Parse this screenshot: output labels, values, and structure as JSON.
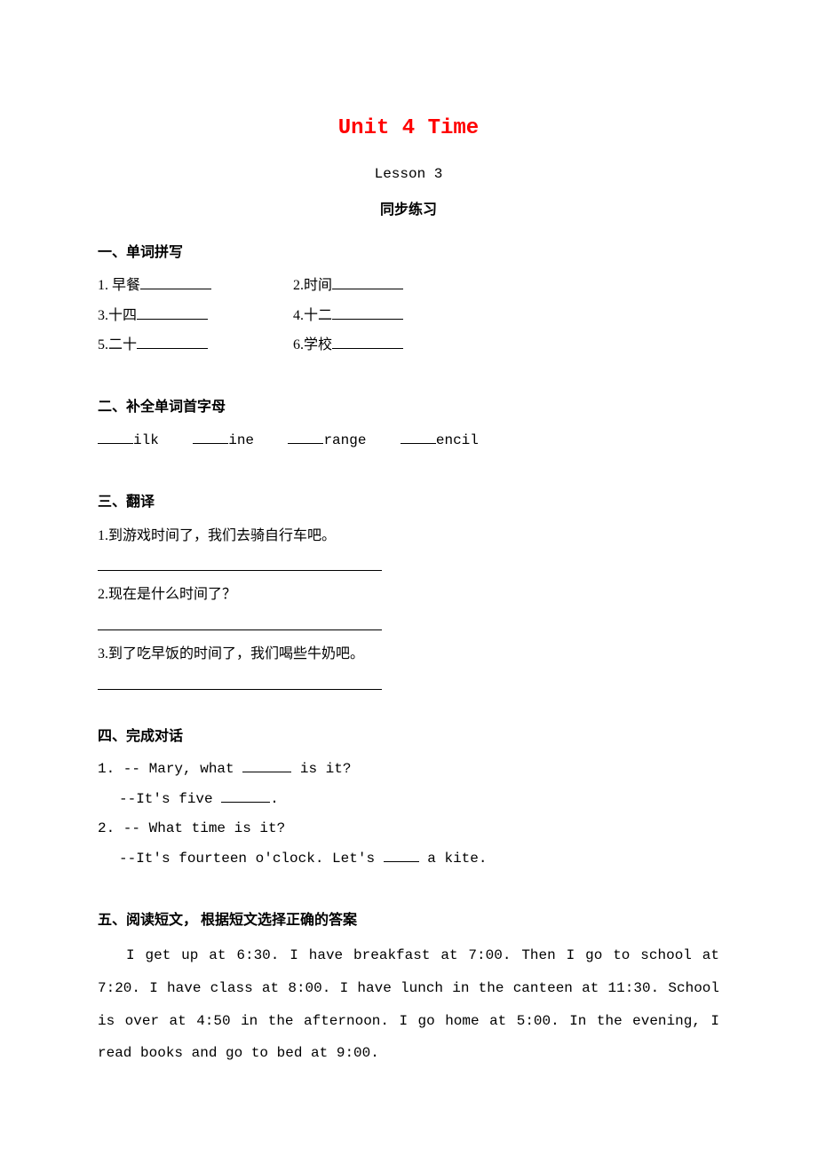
{
  "title": "Unit 4 Time",
  "lesson": "Lesson 3",
  "subtitle": "同步练习",
  "sections": {
    "s1": {
      "heading": "一、单词拼写",
      "items": {
        "i1a": "1. 早餐",
        "i1b": "2.时间",
        "i2a": "3.十四",
        "i2b": "4.十二",
        "i3a": "5.二十",
        "i3b": "6.学校"
      }
    },
    "s2": {
      "heading": "二、补全单词首字母",
      "frag1": "ilk",
      "frag2": "ine",
      "frag3": "range",
      "frag4": "encil"
    },
    "s3": {
      "heading": "三、翻译",
      "q1": "1.到游戏时间了，我们去骑自行车吧。",
      "q2": "2.现在是什么时间了？",
      "q3": "3.到了吃早饭的时间了，我们喝些牛奶吧。"
    },
    "s4": {
      "heading": "四、完成对话",
      "l1a": "1. -- Mary, what ",
      "l1b": " is it?",
      "l2a": "--It's five ",
      "l2b": ".",
      "l3": "2. -- What time is it?",
      "l4a": "--It's fourteen o'clock. Let's ",
      "l4b": " a kite."
    },
    "s5": {
      "heading": "五、阅读短文， 根据短文选择正确的答案",
      "passage": "I get up at 6:30. I have breakfast at 7:00. Then I go to school at 7:20. I have class at 8:00. I have lunch in the canteen at 11:30. School is over at 4:50 in the afternoon. I go home at 5:00. In the evening, I read books and go to bed at 9:00."
    }
  }
}
